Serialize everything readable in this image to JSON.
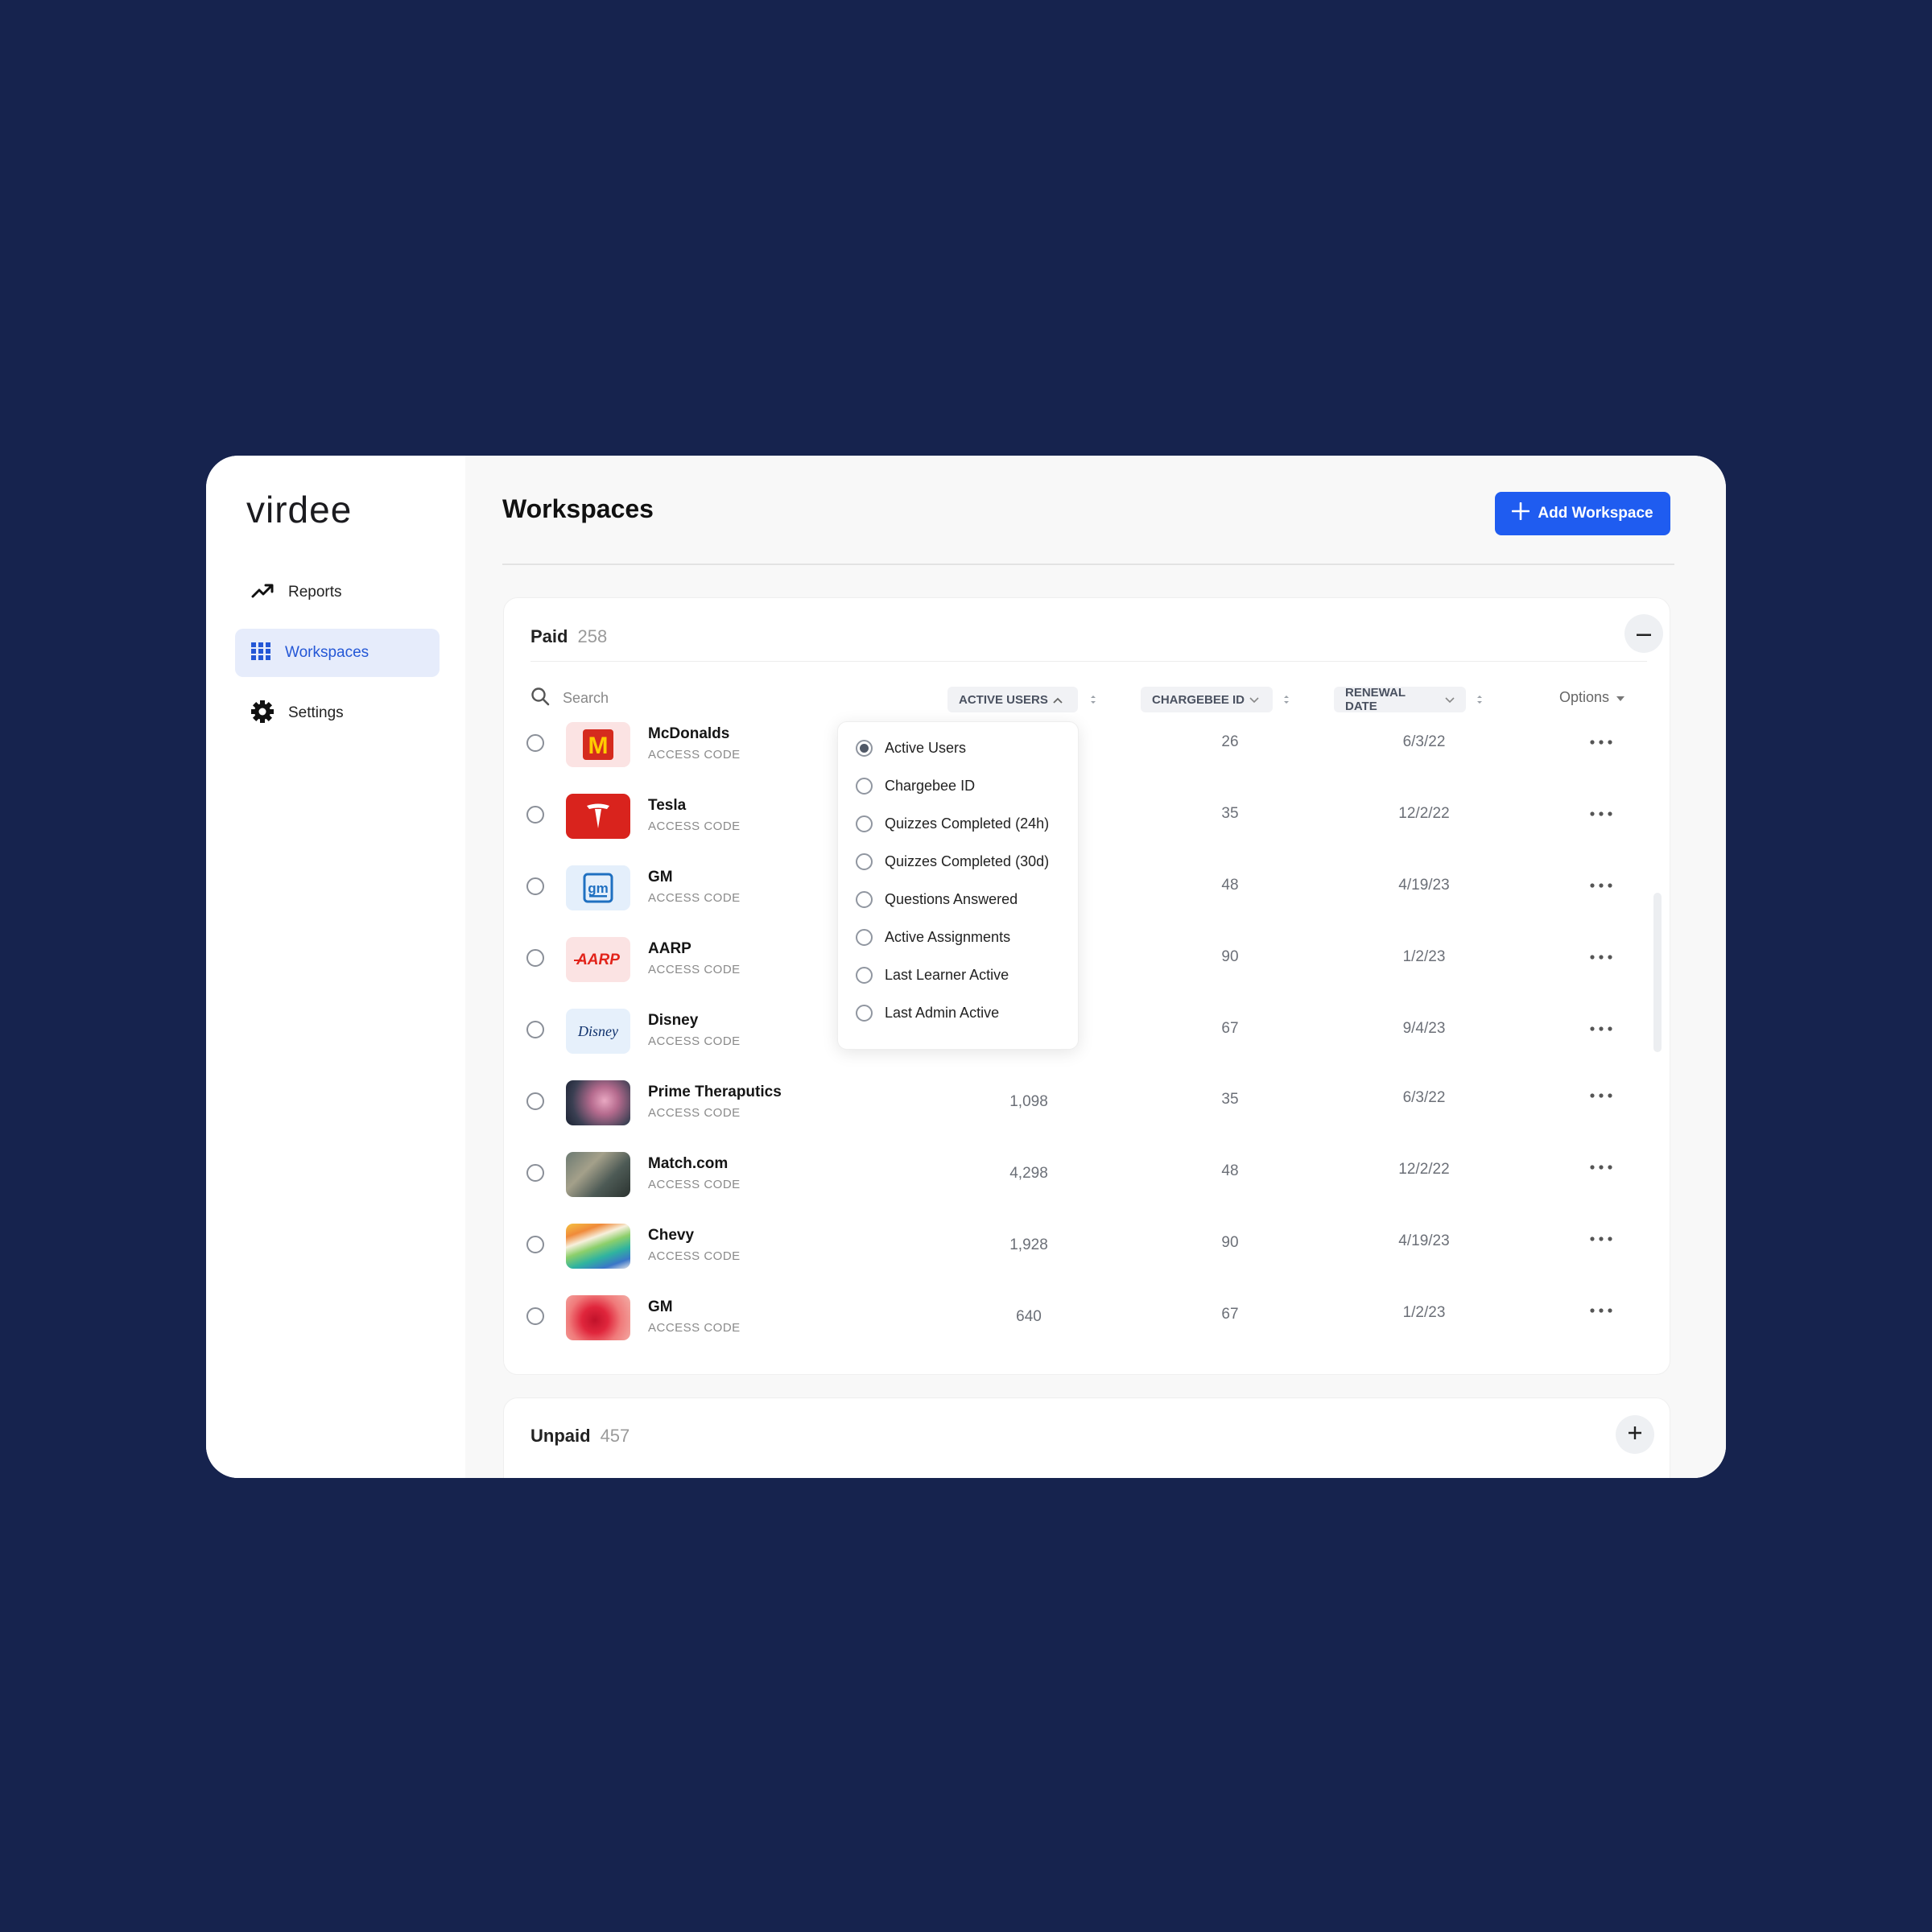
{
  "app": {
    "logo": "virdee",
    "nav": [
      {
        "label": "Reports",
        "icon": "trending-up-icon",
        "active": false
      },
      {
        "label": "Workspaces",
        "icon": "grid-icon",
        "active": true
      },
      {
        "label": "Settings",
        "icon": "gear-icon",
        "active": false
      }
    ],
    "accent_color": "#1f5cf0"
  },
  "page": {
    "title": "Workspaces",
    "add_button_label": "Add Workspace"
  },
  "paid": {
    "title": "Paid",
    "count": "258",
    "search_placeholder": "Search",
    "columns": {
      "active_users": "ACTIVE USERS",
      "chargebee_id": "CHARGEBEE ID",
      "renewal_date": "RENEWAL DATE",
      "options": "Options"
    },
    "rows": [
      {
        "name": "McDonalds",
        "sub": "ACCESS CODE",
        "active_users": "",
        "chargebee_id": "26",
        "renewal_date": "6/3/22",
        "logo": "mcdonalds-logo"
      },
      {
        "name": "Tesla",
        "sub": "ACCESS CODE",
        "active_users": "",
        "chargebee_id": "35",
        "renewal_date": "12/2/22",
        "logo": "tesla-logo"
      },
      {
        "name": "GM",
        "sub": "ACCESS CODE",
        "active_users": "",
        "chargebee_id": "48",
        "renewal_date": "4/19/23",
        "logo": "gm-logo"
      },
      {
        "name": "AARP",
        "sub": "ACCESS CODE",
        "active_users": "",
        "chargebee_id": "90",
        "renewal_date": "1/2/23",
        "logo": "aarp-logo"
      },
      {
        "name": "Disney",
        "sub": "ACCESS CODE",
        "active_users": "",
        "chargebee_id": "67",
        "renewal_date": "9/4/23",
        "logo": "disney-logo"
      },
      {
        "name": "Prime Theraputics",
        "sub": "ACCESS CODE",
        "active_users": "1,098",
        "chargebee_id": "35",
        "renewal_date": "6/3/22",
        "logo": "photo-thumbnail"
      },
      {
        "name": "Match.com",
        "sub": "ACCESS CODE",
        "active_users": "4,298",
        "chargebee_id": "48",
        "renewal_date": "12/2/22",
        "logo": "photo-thumbnail"
      },
      {
        "name": "Chevy",
        "sub": "ACCESS CODE",
        "active_users": "1,928",
        "chargebee_id": "90",
        "renewal_date": "4/19/23",
        "logo": "photo-thumbnail"
      },
      {
        "name": "GM",
        "sub": "ACCESS CODE",
        "active_users": "640",
        "chargebee_id": "67",
        "renewal_date": "1/2/23",
        "logo": "photo-thumbnail"
      }
    ],
    "column_dropdown": {
      "selected": "Active Users",
      "options": [
        "Active Users",
        "Chargebee ID",
        "Quizzes Completed (24h)",
        "Quizzes Completed (30d)",
        "Questions Answered",
        "Active Assignments",
        "Last Learner Active",
        "Last Admin Active"
      ]
    },
    "logo_texts": {
      "disney": "Disney",
      "aarp": "AARP",
      "gm": "gm",
      "mcdonalds": "M"
    }
  },
  "unpaid": {
    "title": "Unpaid",
    "count": "457"
  }
}
